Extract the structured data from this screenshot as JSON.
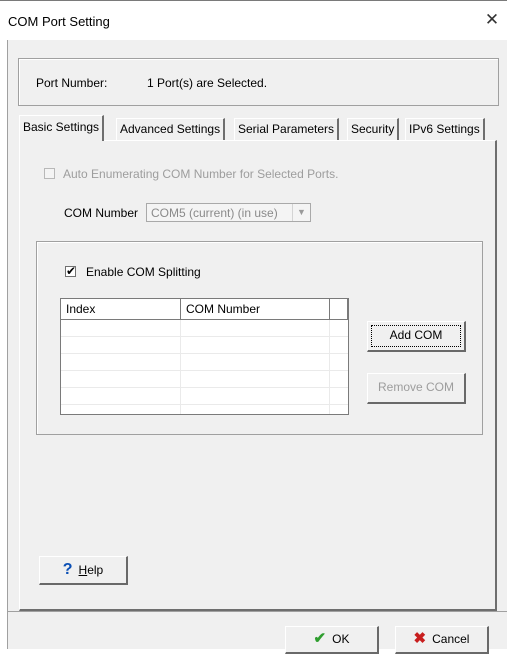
{
  "window": {
    "title": "COM Port Setting",
    "close_glyph": "✕"
  },
  "port": {
    "label": "Port Number:",
    "value": "1 Port(s) are Selected."
  },
  "tabs": [
    {
      "label": "Basic Settings",
      "active": true
    },
    {
      "label": "Advanced Settings",
      "active": false
    },
    {
      "label": "Serial Parameters",
      "active": false
    },
    {
      "label": "Security",
      "active": false
    },
    {
      "label": "IPv6 Settings",
      "active": false
    }
  ],
  "basic": {
    "auto_enum_label": "Auto Enumerating COM Number for Selected Ports.",
    "auto_enum_checked": false,
    "auto_enum_enabled": false,
    "com_number_label": "COM Number",
    "com_number_value": "COM5 (current) (in use)",
    "enable_split_label": "Enable COM Splitting",
    "enable_split_checked": true,
    "check_glyph": "✔",
    "columns": [
      "Index",
      "COM Number"
    ],
    "rows": []
  },
  "buttons": {
    "add_com": "Add COM",
    "remove_com": "Remove COM",
    "help": "Help",
    "help_glyph": "?",
    "ok": "OK",
    "ok_glyph": "✔",
    "cancel": "Cancel",
    "cancel_glyph": "✖"
  },
  "icons": {
    "close": "close-icon",
    "help": "help-question-icon",
    "ok": "checkmark-icon",
    "cancel": "x-icon",
    "dropdown": "chevron-down-icon"
  },
  "colors": {
    "window_bg": "#f0f0f0",
    "disabled_text": "#9d9d9d",
    "help_blue": "#0a4fb5",
    "ok_green": "#2f9e2f",
    "cancel_red": "#c81e1e"
  }
}
